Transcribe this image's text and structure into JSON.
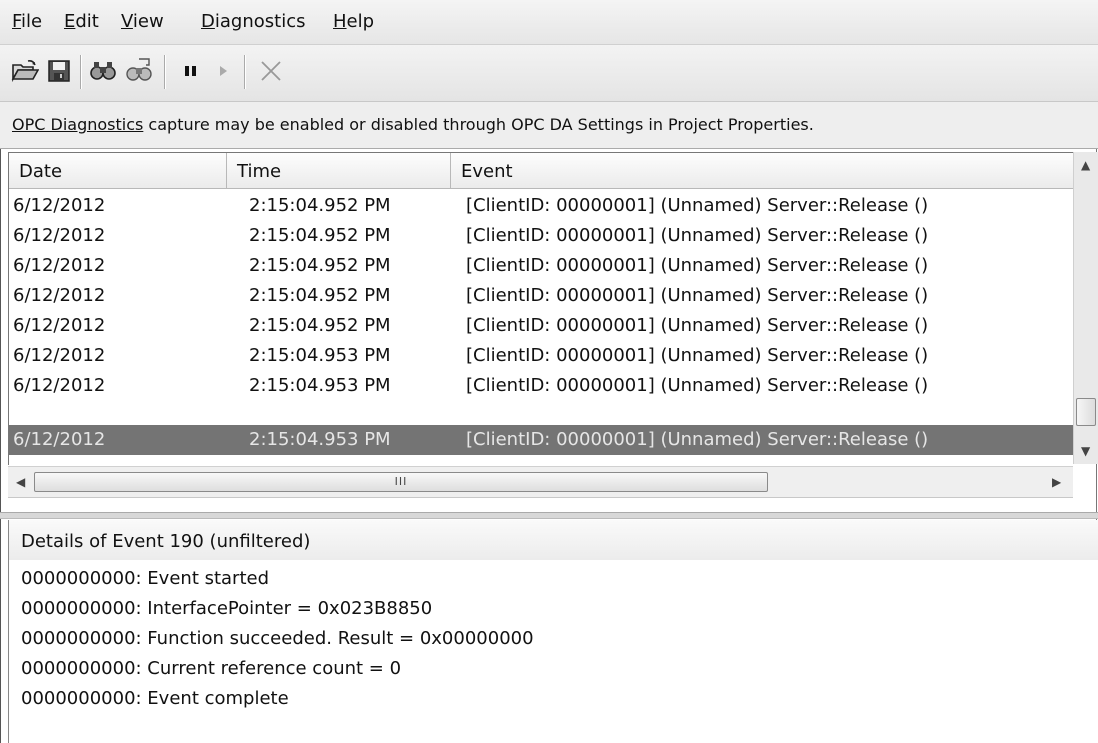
{
  "menu": [
    {
      "mnemonic": "F",
      "rest": "ile"
    },
    {
      "mnemonic": "E",
      "rest": "dit"
    },
    {
      "mnemonic": "V",
      "rest": "iew"
    },
    {
      "mnemonic": "D",
      "rest": "iagnostics"
    },
    {
      "mnemonic": "H",
      "rest": "elp"
    }
  ],
  "toolbar": {
    "icons": [
      "open-folder-icon",
      "save-icon",
      "find-icon",
      "find-next-icon",
      "pause-icon",
      "play-icon",
      "clear-icon"
    ]
  },
  "info": {
    "link": "OPC Diagnostics",
    "text": " capture may be enabled or disabled through OPC DA Settings in Project Properties."
  },
  "list": {
    "columns": [
      "Date",
      "Time",
      "Event"
    ],
    "rows": [
      {
        "date": "6/12/2012",
        "time": "2:15:04.952 PM",
        "event": "[ClientID: 00000001] (Unnamed) Server::Release ()"
      },
      {
        "date": "6/12/2012",
        "time": "2:15:04.952 PM",
        "event": "[ClientID: 00000001] (Unnamed) Server::Release ()"
      },
      {
        "date": "6/12/2012",
        "time": "2:15:04.952 PM",
        "event": "[ClientID: 00000001] (Unnamed) Server::Release ()"
      },
      {
        "date": "6/12/2012",
        "time": "2:15:04.952 PM",
        "event": "[ClientID: 00000001] (Unnamed) Server::Release ()"
      },
      {
        "date": "6/12/2012",
        "time": "2:15:04.952 PM",
        "event": "[ClientID: 00000001] (Unnamed) Server::Release ()"
      },
      {
        "date": "6/12/2012",
        "time": "2:15:04.953 PM",
        "event": "[ClientID: 00000001] (Unnamed) Server::Release ()"
      },
      {
        "date": "6/12/2012",
        "time": "2:15:04.953 PM",
        "event": "[ClientID: 00000001] (Unnamed) Server::Release ()"
      },
      {
        "date": "6/12/2012",
        "time": "2:15:04.953 PM",
        "event": "[ClientID: 00000001] (Unnamed) Server::Release ()"
      }
    ],
    "selected_row": 7,
    "hscroll_grip": "III"
  },
  "details": {
    "title": "Details of Event 190 (unfiltered)",
    "lines": [
      "0000000000: Event started",
      "0000000000: InterfacePointer = 0x023B8850",
      "0000000000: Function succeeded.  Result = 0x00000000",
      "0000000000: Current reference count = 0",
      "0000000000: Event complete"
    ]
  },
  "colors": {
    "selection": "#747474",
    "selection_text": "#e6e6e6"
  }
}
